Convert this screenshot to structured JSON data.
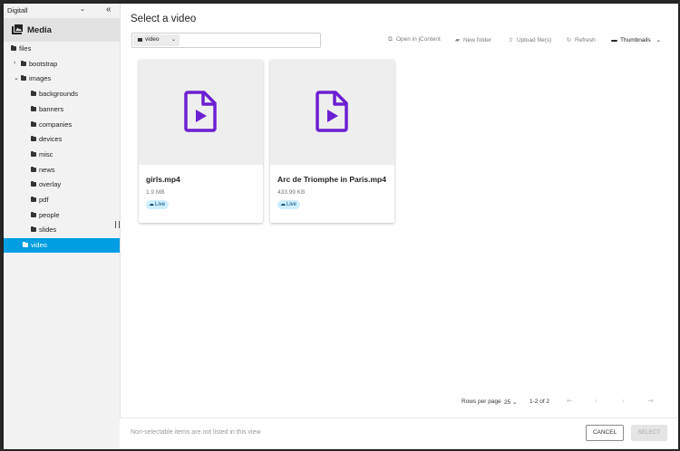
{
  "sidebar": {
    "site": "Digitall",
    "collapse_icon": "«",
    "section_title": "Media",
    "tree": [
      {
        "label": "files",
        "level": 0
      },
      {
        "label": "bootstrap",
        "level": 1,
        "chevron": "›"
      },
      {
        "label": "images",
        "level": 1,
        "chevron": "⌄"
      },
      {
        "label": "backgrounds",
        "level": 2
      },
      {
        "label": "banners",
        "level": 2
      },
      {
        "label": "companies",
        "level": 2
      },
      {
        "label": "devices",
        "level": 2
      },
      {
        "label": "misc",
        "level": 2
      },
      {
        "label": "news",
        "level": 2
      },
      {
        "label": "overlay",
        "level": 2
      },
      {
        "label": "pdf",
        "level": 2
      },
      {
        "label": "people",
        "level": 2
      },
      {
        "label": "slides",
        "level": 2
      },
      {
        "label": "video",
        "level": 1,
        "selected": true
      }
    ]
  },
  "main": {
    "title": "Select a video",
    "path": "video",
    "toolbar": {
      "open_in_jcontent": "Open in jContent",
      "new_folder": "New folder",
      "upload_files": "Upload file(s)",
      "refresh": "Refresh",
      "view_mode": "Thumbnails"
    },
    "files": [
      {
        "name": "girls.mp4",
        "size": "1.9 MB",
        "status": "Live"
      },
      {
        "name": "Arc de Triomphe in Paris.mp4",
        "size": "433.99 KB",
        "status": "Live"
      }
    ],
    "pagination": {
      "rows_per_page_label": "Rows per page",
      "rows_per_page": "25",
      "range": "1-2 of 2"
    },
    "footer_note": "Non-selectable items are not listed in this view",
    "cancel_label": "CANCEL",
    "select_label": "SELECT"
  },
  "colors": {
    "accent": "#009ee3",
    "video_icon": "#6b1fd1",
    "badge_bg": "#cfeeff"
  }
}
